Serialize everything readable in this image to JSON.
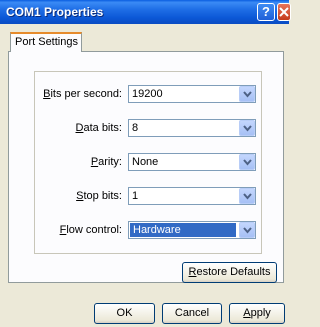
{
  "window": {
    "title": "COM1 Properties",
    "help_glyph": "?",
    "close_icon": "close-icon"
  },
  "tabs": [
    {
      "label": "Port Settings",
      "selected": true
    }
  ],
  "settings": {
    "bits_per_second": {
      "label_prefix": "",
      "label_key": "B",
      "label_rest": "its per second:",
      "value": "19200"
    },
    "data_bits": {
      "label_prefix": "",
      "label_key": "D",
      "label_rest": "ata bits:",
      "value": "8"
    },
    "parity": {
      "label_prefix": "",
      "label_key": "P",
      "label_rest": "arity:",
      "value": "None"
    },
    "stop_bits": {
      "label_prefix": "",
      "label_key": "S",
      "label_rest": "top bits:",
      "value": "1"
    },
    "flow_control": {
      "label_prefix": "",
      "label_key": "F",
      "label_rest": "low control:",
      "value": "Hardware"
    }
  },
  "restore_button": {
    "key": "R",
    "rest": "estore Defaults"
  },
  "footer_buttons": {
    "ok": "OK",
    "cancel": "Cancel",
    "apply_key": "A",
    "apply_rest": "pply"
  },
  "colors": {
    "title_bar": "#0a5ee0",
    "dialog_bg": "#ece9d8",
    "selection": "#316ac5"
  }
}
